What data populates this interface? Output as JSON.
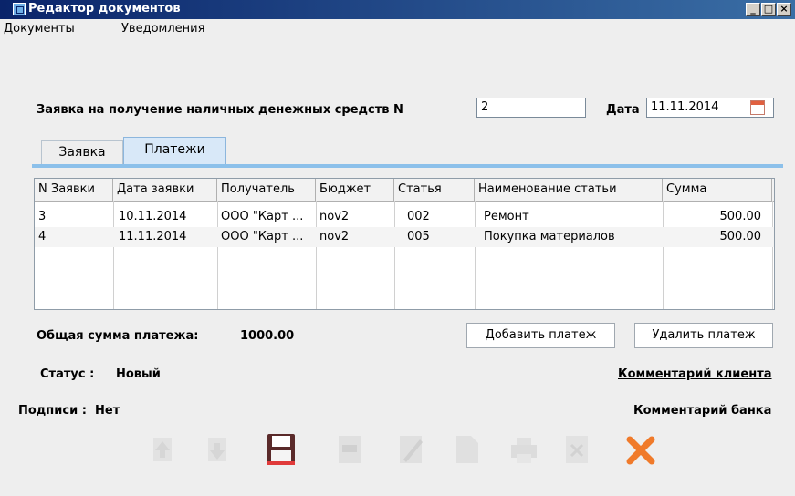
{
  "window": {
    "title": "Редактор документов"
  },
  "menu": [
    "Документы",
    "Уведомления"
  ],
  "form": {
    "heading": "Заявка на получение наличных денежных средств N",
    "number": "2",
    "date_label": "Дата",
    "date_value": "11.11.2014"
  },
  "tabs": [
    {
      "label": "Заявка",
      "active": false
    },
    {
      "label": "Платежи",
      "active": true
    }
  ],
  "table": {
    "columns": [
      "N Заявки",
      "Дата заявки",
      "Получатель",
      "Бюджет",
      "Статья",
      "Наименование статьи",
      "Сумма"
    ],
    "rows": [
      [
        "3",
        "10.11.2014",
        "ООО \"Карт ...",
        "nov2",
        "002",
        "Ремонт",
        "500.00"
      ],
      [
        "4",
        "11.11.2014",
        "ООО \"Карт ...",
        "nov2",
        "005",
        "Покупка материалов",
        "500.00"
      ]
    ]
  },
  "total": {
    "label": "Общая сумма платежа:",
    "value": "1000.00"
  },
  "buttons": {
    "add": "Добавить платеж",
    "delete": "Удалить платеж"
  },
  "status": {
    "label": "Статус :",
    "value": "Новый"
  },
  "signatures": {
    "label": "Подписи :",
    "value": "Нет"
  },
  "client_comment": "Комментарий клиента",
  "bank_comment": "Комментарий банка",
  "toolbar_icons": [
    "arrow-up-icon",
    "arrow-down-icon",
    "save-icon",
    "document-icon",
    "edit-icon",
    "document-icon",
    "print-icon",
    "delete-icon",
    "close-icon"
  ],
  "colors": {
    "titlebar": "#0a246a",
    "tab_accent": "#8cc0ea",
    "close_x": "#f07a2a"
  }
}
